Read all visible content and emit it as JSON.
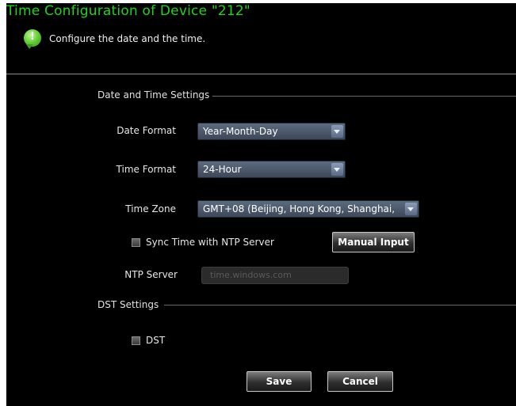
{
  "header": {
    "title": "Time Configuration of Device \"212\"",
    "subtitle": "Configure the date and the time.",
    "icon": "info-icon"
  },
  "date_time_settings": {
    "section_title": "Date and Time Settings",
    "date_format": {
      "label": "Date Format",
      "value": "Year-Month-Day"
    },
    "time_format": {
      "label": "Time Format",
      "value": "24-Hour"
    },
    "time_zone": {
      "label": "Time Zone",
      "value": "GMT+08 (Beijing, Hong Kong, Shanghai,"
    },
    "sync_ntp": {
      "label": "Sync Time with NTP Server",
      "checked": false
    },
    "manual_input_label": "Manual Input",
    "ntp_server": {
      "label": "NTP Server",
      "value": "time.windows.com"
    }
  },
  "dst_settings": {
    "section_title": "DST Settings",
    "dst": {
      "label": "DST",
      "checked": false
    }
  },
  "actions": {
    "save_label": "Save",
    "cancel_label": "Cancel"
  },
  "colors": {
    "title": "#1cd41c",
    "background": "#000000",
    "select": "#4b576a"
  }
}
